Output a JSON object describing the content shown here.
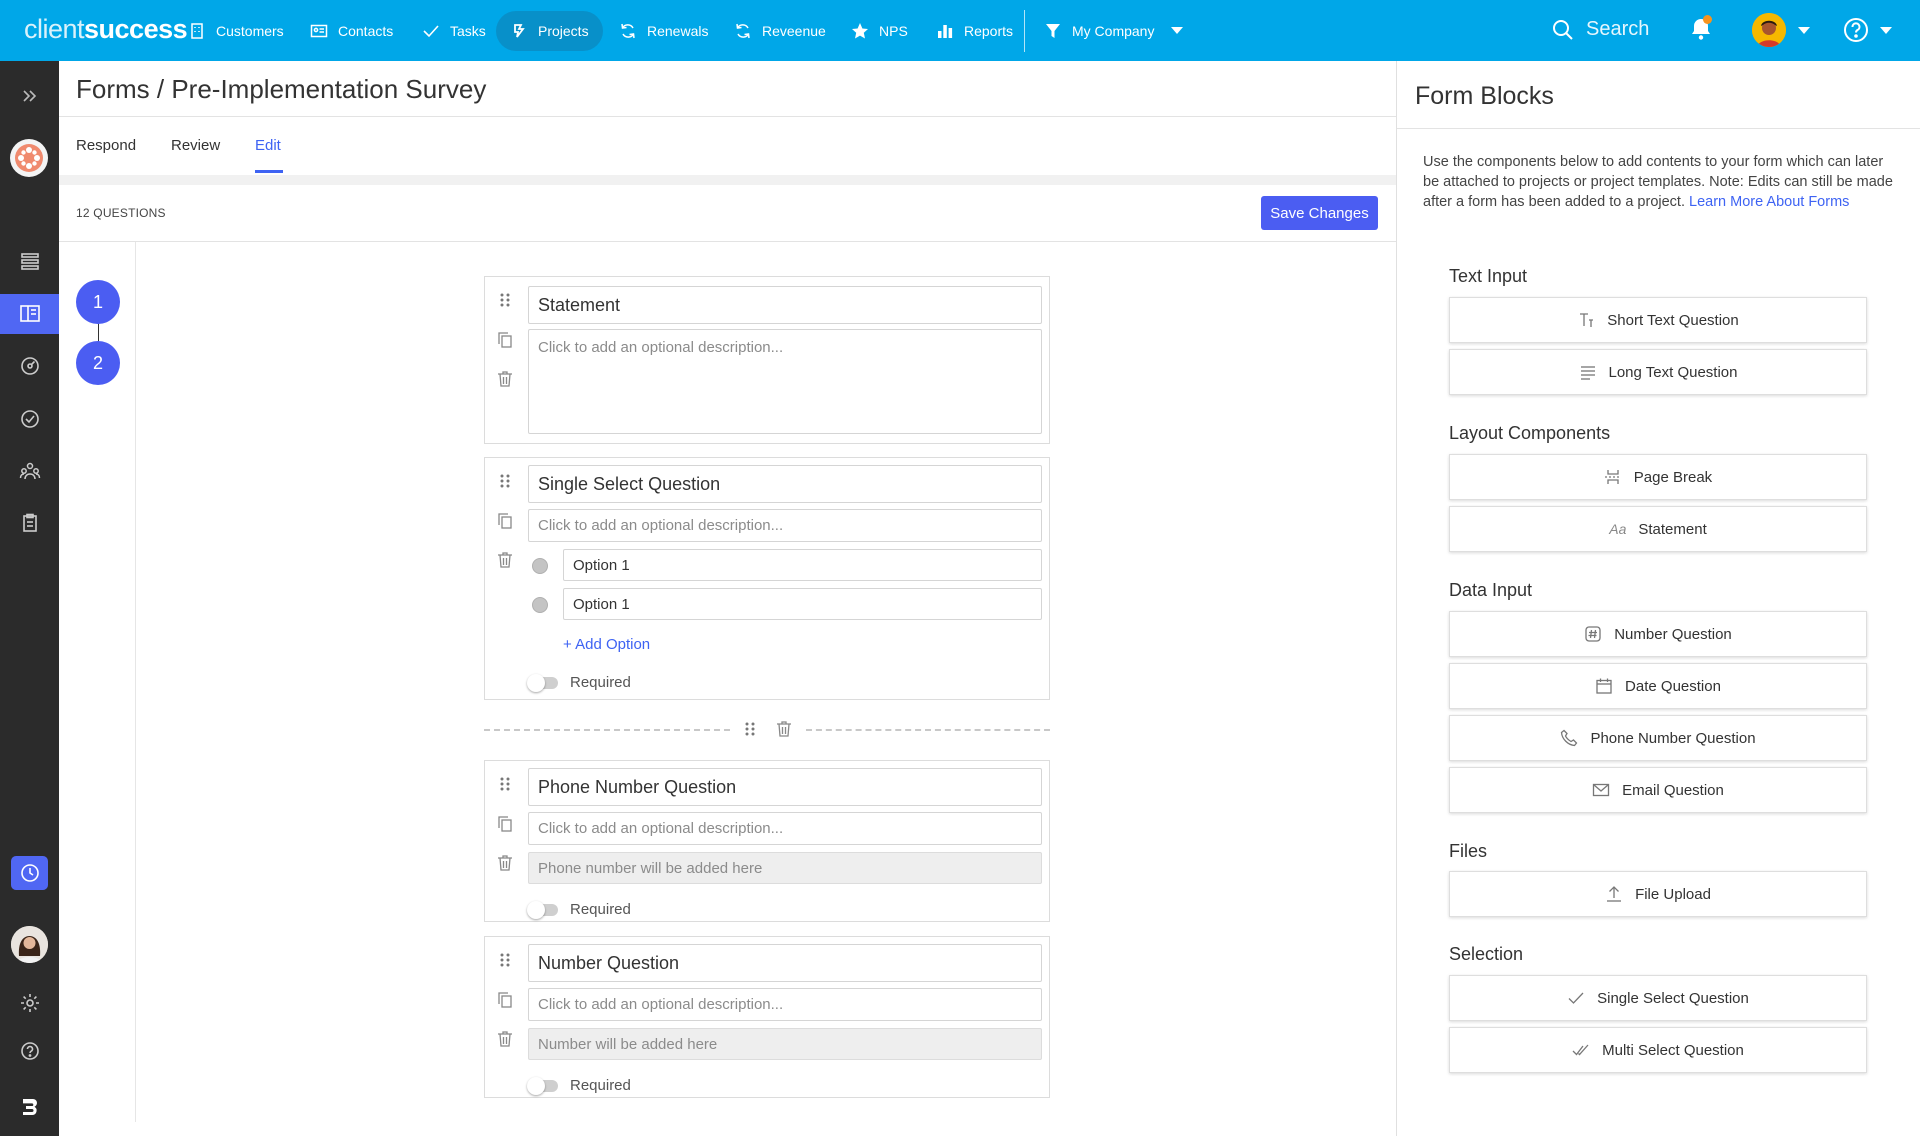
{
  "topnav": {
    "logo_part1": "client",
    "logo_part2": "success",
    "items": [
      {
        "label": "Customers",
        "icon": "building-icon"
      },
      {
        "label": "Contacts",
        "icon": "contact-card-icon"
      },
      {
        "label": "Tasks",
        "icon": "check-icon"
      },
      {
        "label": "Projects",
        "icon": "projects-icon",
        "active": true
      },
      {
        "label": "Renewals",
        "icon": "refresh-icon"
      },
      {
        "label": "Reveenue",
        "icon": "refresh-icon"
      },
      {
        "label": "NPS",
        "icon": "star-icon"
      },
      {
        "label": "Reports",
        "icon": "bar-chart-icon"
      },
      {
        "label": "My Company",
        "icon": "filter-icon"
      }
    ],
    "search_placeholder": "Search"
  },
  "page": {
    "breadcrumb": "Forms / Pre-Implementation Survey",
    "tabs": [
      "Respond",
      "Review",
      "Edit"
    ],
    "active_tab": "Edit",
    "question_count": "12 QUESTIONS",
    "save_label": "Save Changes",
    "steps": [
      "1",
      "2"
    ]
  },
  "questions": [
    {
      "title": "Statement",
      "description": "Click to add an optional description..."
    },
    {
      "title": "Single Select Question",
      "description": "Click to add an optional description...",
      "options": [
        "Option 1",
        "Option 1"
      ],
      "add_option": "+ Add Option",
      "required_label": "Required"
    },
    {
      "title": "Phone Number Question",
      "description": "Click to add an optional description...",
      "placeholder": "Phone number will be added here",
      "required_label": "Required"
    },
    {
      "title": "Number Question",
      "description": "Click to add an optional description...",
      "placeholder": "Number will be added here",
      "required_label": "Required"
    }
  ],
  "panel": {
    "title": "Form Blocks",
    "description": "Use the components below to add contents to your form which can later be attached to projects or project templates. Note: Edits can still be made after a form has been added to a project.",
    "link": "Learn More About Forms",
    "sections": [
      {
        "title": "Text Input",
        "blocks": [
          {
            "label": "Short Text Question",
            "icon": "text-cursor-icon"
          },
          {
            "label": "Long Text Question",
            "icon": "lines-icon"
          }
        ]
      },
      {
        "title": "Layout Components",
        "blocks": [
          {
            "label": "Page Break",
            "icon": "page-break-icon"
          },
          {
            "label": "Statement",
            "icon": "aa-icon",
            "icon_text": "Aa"
          }
        ]
      },
      {
        "title": "Data Input",
        "blocks": [
          {
            "label": "Number Question",
            "icon": "hash-icon"
          },
          {
            "label": "Date Question",
            "icon": "calendar-icon"
          },
          {
            "label": "Phone Number Question",
            "icon": "phone-icon"
          },
          {
            "label": "Email Question",
            "icon": "envelope-icon"
          }
        ]
      },
      {
        "title": "Files",
        "blocks": [
          {
            "label": "File Upload",
            "icon": "upload-icon"
          }
        ]
      },
      {
        "title": "Selection",
        "blocks": [
          {
            "label": "Single Select Question",
            "icon": "check-icon"
          },
          {
            "label": "Multi Select Question",
            "icon": "double-check-icon"
          }
        ]
      }
    ]
  },
  "colors": {
    "nav": "#00a7e8",
    "accent": "#4b5df2",
    "sidebar": "#2b2b2b",
    "link": "#3e63f3"
  }
}
